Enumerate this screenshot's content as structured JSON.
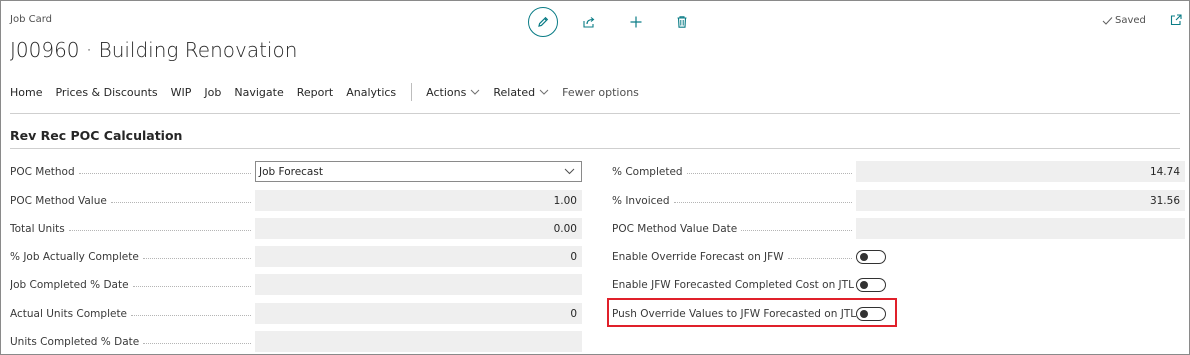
{
  "header": {
    "caption": "Job Card",
    "title": "J00960 · Building Renovation",
    "saved_label": "Saved"
  },
  "toolbar": {
    "icons": [
      "edit-icon",
      "share-icon",
      "plus-icon",
      "delete-icon"
    ]
  },
  "menu": {
    "home": "Home",
    "prices_discounts": "Prices & Discounts",
    "wip": "WIP",
    "job": "Job",
    "navigate": "Navigate",
    "report": "Report",
    "analytics": "Analytics",
    "actions": "Actions",
    "related": "Related",
    "fewer_options": "Fewer options"
  },
  "section": {
    "title": "Rev Rec POC Calculation"
  },
  "left_fields": {
    "poc_method": {
      "label": "POC Method",
      "value": "Job Forecast"
    },
    "poc_method_value": {
      "label": "POC Method Value",
      "value": "1.00"
    },
    "total_units": {
      "label": "Total Units",
      "value": "0.00"
    },
    "pct_job_actually_complete": {
      "label": "% Job Actually Complete",
      "value": "0"
    },
    "job_completed_pct_date": {
      "label": "Job Completed % Date",
      "value": ""
    },
    "actual_units_complete": {
      "label": "Actual Units Complete",
      "value": "0"
    },
    "units_completed_pct_date": {
      "label": "Units Completed % Date",
      "value": ""
    }
  },
  "right_fields": {
    "pct_completed": {
      "label": "% Completed",
      "value": "14.74"
    },
    "pct_invoiced": {
      "label": "% Invoiced",
      "value": "31.56"
    },
    "poc_method_value_date": {
      "label": "POC Method Value Date",
      "value": ""
    },
    "enable_override_forecast": {
      "label": "Enable Override Forecast on JFW",
      "on": false
    },
    "enable_jfw_forecasted": {
      "label": "Enable JFW Forecasted Completed Cost on JTL",
      "on": false
    },
    "push_override_values": {
      "label": "Push Override Values to JFW Forecasted on JTL",
      "on": false
    }
  },
  "colors": {
    "accent": "#0a7c86",
    "highlight": "#e0202a"
  }
}
